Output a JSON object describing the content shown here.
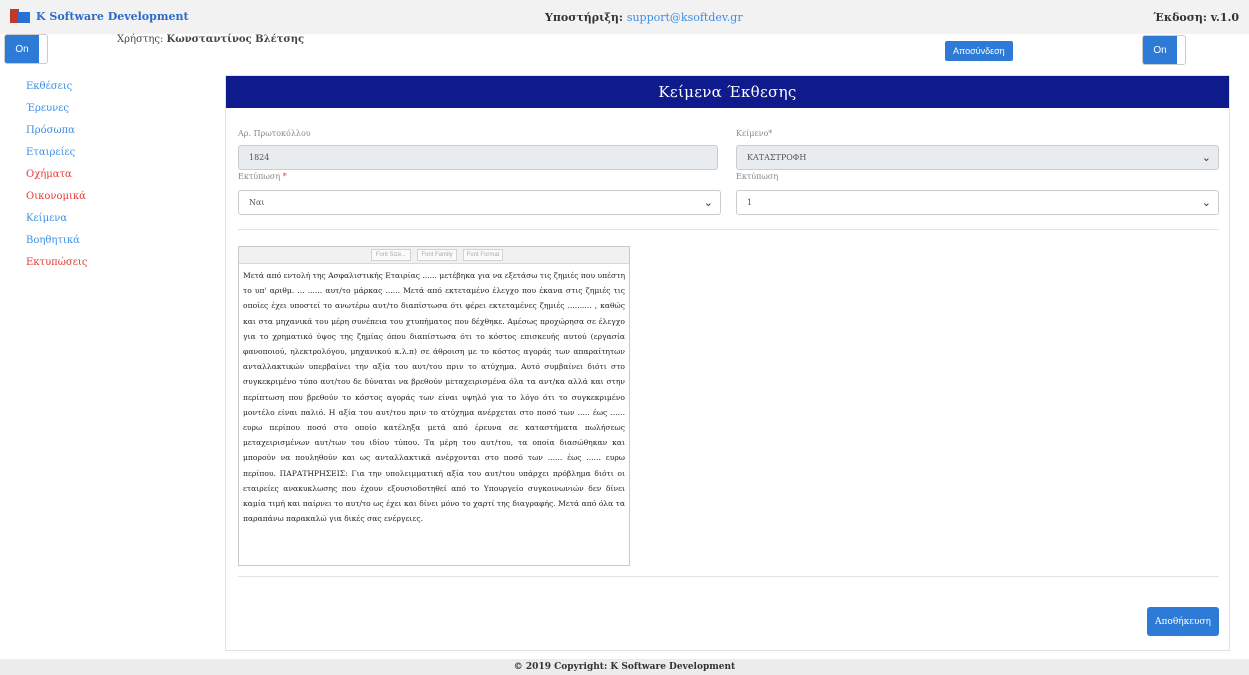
{
  "topbar": {
    "brand": "K Software Development",
    "support_label": "Υποστήριξη:",
    "support_email": "support@ksoftdev.gr",
    "version": "Έκδοση: v.1.0"
  },
  "user": {
    "label": "Χρήστης:",
    "name": "Κωνσταντίνος Βλέτσης"
  },
  "toggles": {
    "left": "On",
    "right": "On"
  },
  "logout_label": "Αποσύνδεση",
  "sidebar": {
    "items": [
      {
        "label": "Εκθέσεις",
        "color": "#3a8ee6"
      },
      {
        "label": "Έρευνες",
        "color": "#3a8ee6"
      },
      {
        "label": "Πρόσωπα",
        "color": "#3a8ee6"
      },
      {
        "label": "Εταιρείες",
        "color": "#3a8ee6"
      },
      {
        "label": "Οχήματα",
        "color": "#e53935"
      },
      {
        "label": "Οικονομικά",
        "color": "#e53935"
      },
      {
        "label": "Κείμενα",
        "color": "#3a8ee6"
      },
      {
        "label": "Βοηθητικά",
        "color": "#3a8ee6"
      },
      {
        "label": "Εκτυπώσεις",
        "color": "#e53935"
      }
    ]
  },
  "panel": {
    "title": "Κείμενα Έκθεσης",
    "protocol_label": "Αρ. Πρωτοκόλλου",
    "protocol_value": "1824",
    "text_label": "Κείμενο*",
    "text_value": "ΚΑΤΑΣΤΡΟΦΗ",
    "print_label": "Εκτύπωση",
    "print_required": "*",
    "print_value": "Ναι",
    "print2_label": "Εκτύπωση",
    "print2_value": "1"
  },
  "editor": {
    "toolbar": {
      "font_size": "Font Size...",
      "font_family": "Font Family",
      "font_format": "Font Format"
    },
    "content": "Μετά από εντολή της Ασφαλιστικής Εταιρίας ...... μετέβηκα για να εξετάσω τις ζημιές που υπέστη το υπ' αριθμ. ... ...... αυτ/το μάρκας ...... Μετά από εκτεταμένο έλεγχο που έκανα στις ζημιές τις οποίες έχει υποστεί το ανωτέρω αυτ/το διαπίστωσα ότι φέρει εκτεταμένες ζημιές .......... , καθώς και στα μηχανικά του μέρη συνέπεια του χτυπήματος που δέχθηκε. Αμέσως προχώρησα σε έλεγχο για το χρηματικό ύψος της ζημίας όπου διαπίστωσα ότι το κόστος επισκευής αυτού (εργασία φανοποιού, ηλεκτρολόγου, μηχανικού κ.λ.π) σε άθροιση με το κόστος αγοράς των απαραίτητων ανταλλακτικών υπερβαίνει την αξία του αυτ/του πριν το ατύχημα. Αυτό συμβαίνει διότι στο συγκεκριμένο τύπο αυτ/του δε δύναται να βρεθούν μεταχειρισμένα όλα τα αντ/κα αλλά και στην περίπτωση που βρεθούν το κόστος αγοράς των είναι υψηλό για το λόγο ότι το συγκεκριμένο μοντέλο είναι παλιό. Η αξία του αυτ/του πριν το ατύχημα ανέρχεται στο ποσό των ..... έως ...... ευρω περίπου ποσό στο οποίο κατέληξα μετά από έρευνα σε καταστήματα πωλήσεως μεταχειρισμένων αυτ/των του ιδίου τύπου. Τα μέρη του αυτ/του, τα οποία διασώθηκαν και μπορούν να πουληθούν και ως ανταλλακτικά ανέρχονται στο ποσό των ...... έως ...... ευρω περίπου. ΠΑΡΑΤΗΡΗΣΕΙΣ: Για την υπολειμματική αξία του αυτ/του υπάρχει πρόβλημα διότι οι εταιρείες ανακυκλωσης που έχουν εξουσιοδοτηθεί από το Υπουργείο συγκοινωνιών δεν δίνει καμία τιμή και παίρνει το αυτ/το ως έχει και δίνει μόνο το χαρτί της διαγραφής. Μετά από όλα τα παραπάνω παρακαλώ για δικές σας ενέργειες."
  },
  "save_label": "Αποθήκευση",
  "footer": "© 2019 Copyright: K Software Development",
  "colors": {
    "primary": "#2d7bd6",
    "header": "#0f1a8c",
    "nav_blue": "#3a8ee6",
    "nav_red": "#e53935"
  }
}
